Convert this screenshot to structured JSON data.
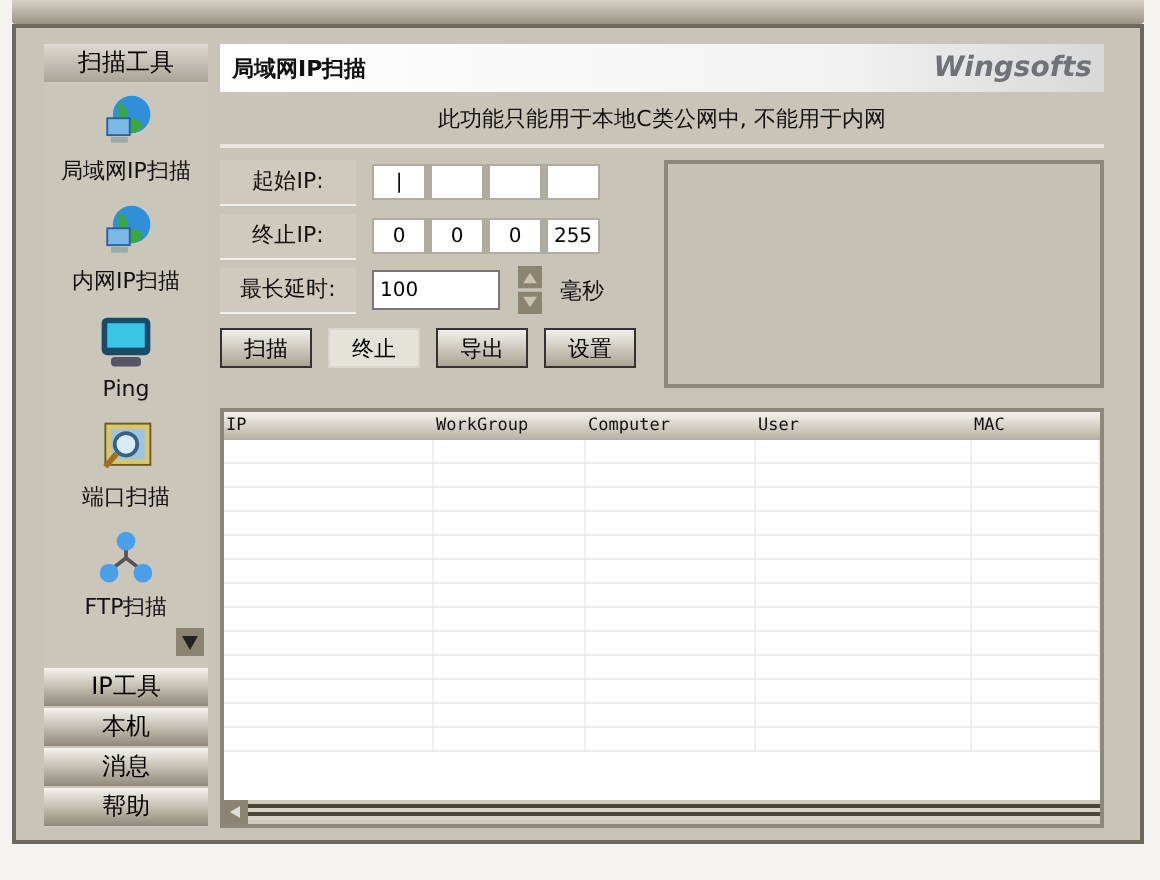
{
  "sidebar": {
    "groups": [
      {
        "label": "扫描工具",
        "selected": true
      },
      {
        "label": "IP工具",
        "selected": false
      },
      {
        "label": "本机",
        "selected": false
      },
      {
        "label": "消息",
        "selected": false
      },
      {
        "label": "帮助",
        "selected": false
      }
    ],
    "tools": [
      {
        "label": "局域网IP扫描",
        "kind": "globe"
      },
      {
        "label": "内网IP扫描",
        "kind": "globe"
      },
      {
        "label": "Ping",
        "kind": "ping"
      },
      {
        "label": "端口扫描",
        "kind": "port"
      },
      {
        "label": "FTP扫描",
        "kind": "ftp"
      }
    ]
  },
  "panel": {
    "title": "局域网IP扫描",
    "brand": "Wingsofts",
    "notice": "此功能只能用于本地C类公网中, 不能用于内网",
    "start_ip": {
      "label": "起始IP:",
      "octets": [
        "|"
      ]
    },
    "end_ip": {
      "label": "终止IP:",
      "octets": [
        "0",
        "0",
        "0",
        "255"
      ]
    },
    "timeout": {
      "label": "最长延时:",
      "value": "100",
      "unit": "毫秒"
    },
    "buttons": [
      {
        "label": "扫描",
        "disabled": false
      },
      {
        "label": "终止",
        "disabled": true
      },
      {
        "label": "导出",
        "disabled": false
      },
      {
        "label": "设置",
        "disabled": false
      }
    ]
  },
  "table": {
    "columns": [
      "IP",
      "WorkGroup",
      "Computer",
      "User",
      "MAC"
    ]
  }
}
